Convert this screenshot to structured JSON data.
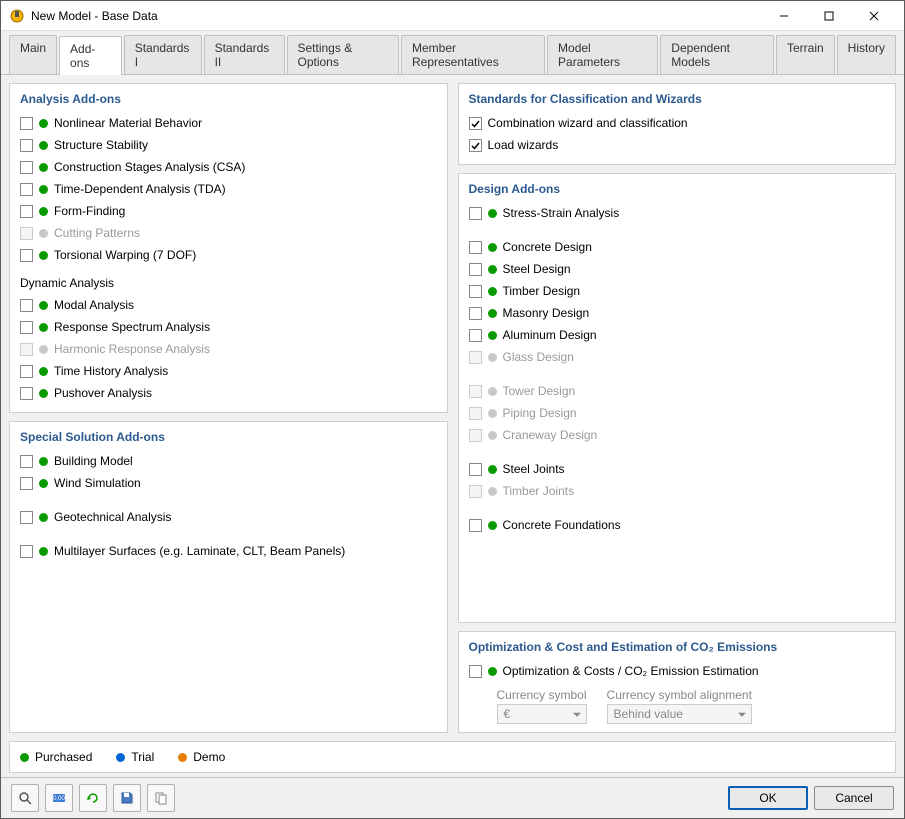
{
  "window": {
    "title": "New Model - Base Data",
    "controls": {
      "minimize": "–",
      "maximize": "☐",
      "close": "✕"
    }
  },
  "tabs": [
    {
      "label": "Main",
      "active": false
    },
    {
      "label": "Add-ons",
      "active": true
    },
    {
      "label": "Standards I",
      "active": false
    },
    {
      "label": "Standards II",
      "active": false
    },
    {
      "label": "Settings & Options",
      "active": false
    },
    {
      "label": "Member Representatives",
      "active": false
    },
    {
      "label": "Model Parameters",
      "active": false
    },
    {
      "label": "Dependent Models",
      "active": false
    },
    {
      "label": "Terrain",
      "active": false
    },
    {
      "label": "History",
      "active": false
    }
  ],
  "sections": {
    "analysis": {
      "title": "Analysis Add-ons",
      "items": [
        {
          "label": "Nonlinear Material Behavior",
          "status": "green"
        },
        {
          "label": "Structure Stability",
          "status": "green"
        },
        {
          "label": "Construction Stages Analysis (CSA)",
          "status": "green"
        },
        {
          "label": "Time-Dependent Analysis (TDA)",
          "status": "green"
        },
        {
          "label": "Form-Finding",
          "status": "green"
        },
        {
          "label": "Cutting Patterns",
          "status": "grey",
          "disabled": true
        },
        {
          "label": "Torsional Warping (7 DOF)",
          "status": "green"
        }
      ],
      "dynamic_title": "Dynamic Analysis",
      "dynamic_items": [
        {
          "label": "Modal Analysis",
          "status": "green"
        },
        {
          "label": "Response Spectrum Analysis",
          "status": "green"
        },
        {
          "label": "Harmonic Response Analysis",
          "status": "grey",
          "disabled": true
        },
        {
          "label": "Time History Analysis",
          "status": "green"
        },
        {
          "label": "Pushover Analysis",
          "status": "green"
        }
      ]
    },
    "special": {
      "title": "Special Solution Add-ons",
      "groups": [
        [
          {
            "label": "Building Model",
            "status": "green"
          },
          {
            "label": "Wind Simulation",
            "status": "green"
          }
        ],
        [
          {
            "label": "Geotechnical Analysis",
            "status": "green"
          }
        ],
        [
          {
            "label": "Multilayer Surfaces (e.g. Laminate, CLT, Beam Panels)",
            "status": "green"
          }
        ]
      ]
    },
    "standards": {
      "title": "Standards for Classification and Wizards",
      "items": [
        {
          "label": "Combination wizard and classification",
          "checked": true
        },
        {
          "label": "Load wizards",
          "checked": true
        }
      ]
    },
    "design": {
      "title": "Design Add-ons",
      "groups": [
        [
          {
            "label": "Stress-Strain Analysis",
            "status": "green"
          }
        ],
        [
          {
            "label": "Concrete Design",
            "status": "green"
          },
          {
            "label": "Steel Design",
            "status": "green"
          },
          {
            "label": "Timber Design",
            "status": "green"
          },
          {
            "label": "Masonry Design",
            "status": "green"
          },
          {
            "label": "Aluminum Design",
            "status": "green"
          },
          {
            "label": "Glass Design",
            "status": "grey",
            "disabled": true
          }
        ],
        [
          {
            "label": "Tower Design",
            "status": "grey",
            "disabled": true
          },
          {
            "label": "Piping Design",
            "status": "grey",
            "disabled": true
          },
          {
            "label": "Craneway Design",
            "status": "grey",
            "disabled": true
          }
        ],
        [
          {
            "label": "Steel Joints",
            "status": "green"
          },
          {
            "label": "Timber Joints",
            "status": "grey",
            "disabled": true
          }
        ],
        [
          {
            "label": "Concrete Foundations",
            "status": "green"
          }
        ]
      ]
    },
    "optimization": {
      "title": "Optimization & Cost and Estimation of CO₂ Emissions",
      "item": {
        "label": "Optimization & Costs / CO₂ Emission Estimation",
        "status": "green"
      },
      "currency_label": "Currency symbol",
      "currency_value": "€",
      "alignment_label": "Currency symbol alignment",
      "alignment_value": "Behind value"
    }
  },
  "legend": {
    "purchased": "Purchased",
    "trial": "Trial",
    "demo": "Demo"
  },
  "footer": {
    "ok": "OK",
    "cancel": "Cancel"
  }
}
